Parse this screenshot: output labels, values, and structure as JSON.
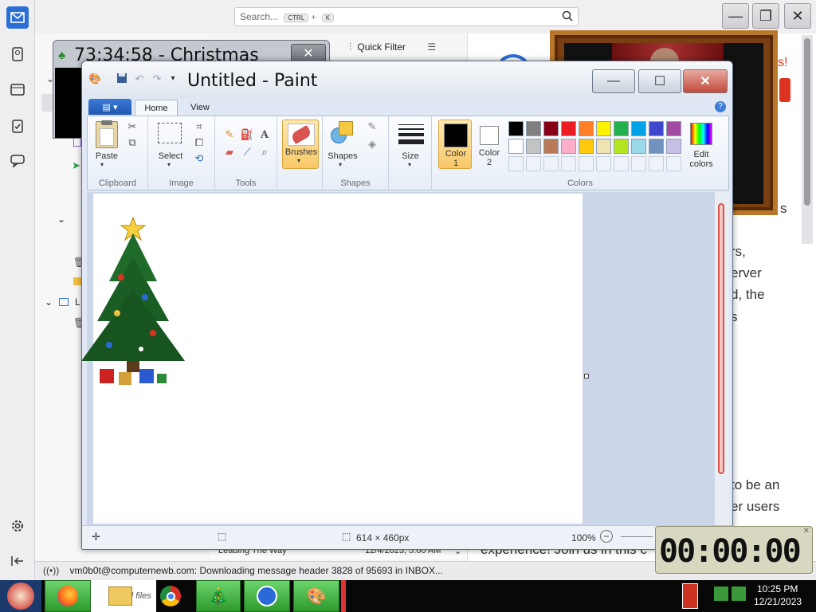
{
  "thunderbird": {
    "search_placeholder": "Search...",
    "search_kbd_ctrl": "CTRL",
    "search_kbd_plus": "+",
    "search_kbd_k": "K",
    "quick_filter": "Quick Filter",
    "message_row": {
      "subject": "Leading The Way",
      "date": "12/4/2023, 5:00 AM"
    },
    "status_text": "vm0b0t@computernewb.com: Downloading message header 3828 of 95693 in INBOX...",
    "preview_fragments": [
      "s",
      "rs,",
      "erver",
      "d, the",
      "s",
      "to be an",
      "er users",
      "experience! Join us in this c"
    ],
    "red_text": "s!"
  },
  "xmas_clock": {
    "title": "73:34:58 - Christmas"
  },
  "paint": {
    "title": "Untitled - Paint",
    "tabs": [
      "Home",
      "View"
    ],
    "clipboard": {
      "paste": "Paste",
      "group": "Clipboard"
    },
    "image": {
      "select": "Select",
      "group": "Image"
    },
    "tools": {
      "group": "Tools"
    },
    "brushes": "Brushes",
    "shapes": {
      "label": "Shapes",
      "group": "Shapes"
    },
    "size": "Size",
    "color1": {
      "label": "Color",
      "num": "1"
    },
    "color2": {
      "label": "Color",
      "num": "2"
    },
    "edit_colors": {
      "line1": "Edit",
      "line2": "colors"
    },
    "colors_group": "Colors",
    "palette_row1": [
      "#000000",
      "#7f7f7f",
      "#880015",
      "#ed1c24",
      "#ff7f27",
      "#fff200",
      "#22b14c",
      "#00a2e8",
      "#3f48cc",
      "#a349a4"
    ],
    "palette_row2": [
      "#ffffff",
      "#c3c3c3",
      "#b97a57",
      "#ffaec9",
      "#ffc90e",
      "#efe4b0",
      "#b5e61d",
      "#99d9ea",
      "#7092be",
      "#c8bfe7"
    ],
    "canvas_size": "614 × 460px",
    "zoom": "100%"
  },
  "timer": "00:00:00",
  "taskbar": {
    "folder_label": "gra d files",
    "time": "10:25 PM",
    "date": "12/21/2023"
  }
}
